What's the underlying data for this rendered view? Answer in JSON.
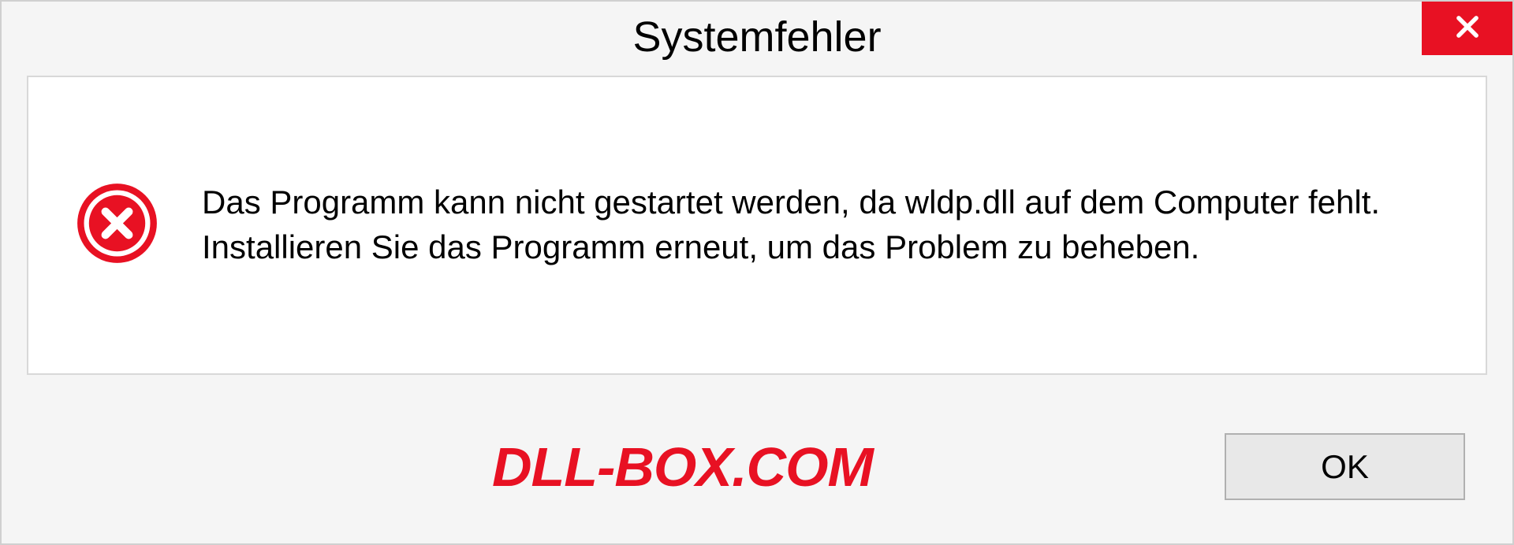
{
  "dialog": {
    "title": "Systemfehler",
    "message": "Das Programm kann nicht gestartet werden, da wldp.dll auf dem Computer fehlt. Installieren Sie das Programm erneut, um das Problem zu beheben.",
    "ok_label": "OK"
  },
  "watermark": "DLL-BOX.COM"
}
